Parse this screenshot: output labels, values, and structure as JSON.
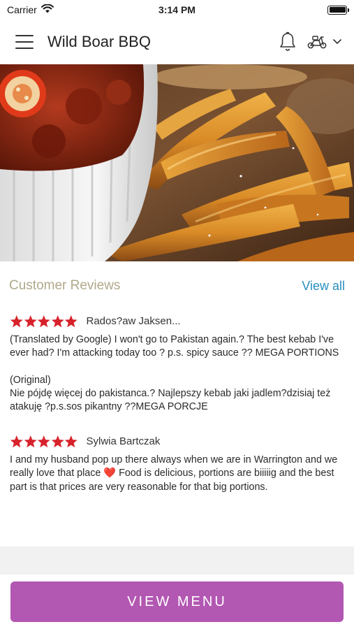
{
  "status_bar": {
    "carrier": "Carrier",
    "time": "3:14 PM",
    "battery_level": 1.0
  },
  "header": {
    "title": "Wild Boar BBQ",
    "menu_icon": "hamburger-menu-icon",
    "notification_icon": "bell-icon",
    "order_mode_icon": "delivery-scooter-icon",
    "dropdown_icon": "chevron-down-icon"
  },
  "hero": {
    "description_icon": "food-photo"
  },
  "reviews": {
    "title": "Customer Reviews",
    "view_all": "View all",
    "items": [
      {
        "author": "Rados?aw Jaksen...",
        "rating": 5,
        "text_translated": "(Translated by Google) I won't go to Pakistan again.? The best kebab I've ever had? I'm attacking today too ? p.s. spicy sauce ?? MEGA PORTIONS",
        "text_original_label": "(Original)",
        "text_original": "Nie pójdę więcej do pakistanca.? Najlepszy kebab jaki jadlem?dzisiaj też atakuję ?p.s.sos pikantny ??MEGA PORCJE"
      },
      {
        "author": "Sylwia Bartczak",
        "rating": 5,
        "text_before_heart": "I and my husband pop up there always when we are in Warrington and we really love that place ",
        "heart": "❤️",
        "text_after_heart": " Food is delicious, portions are biiiiig and the best part is that prices are very reasonable for that big portions."
      }
    ]
  },
  "footer": {
    "view_menu_label": "VIEW MENU"
  },
  "colors": {
    "accent": "#b257b2",
    "link": "#2a8fc1",
    "star": "#d8222b",
    "section_title": "#b0a88a"
  }
}
